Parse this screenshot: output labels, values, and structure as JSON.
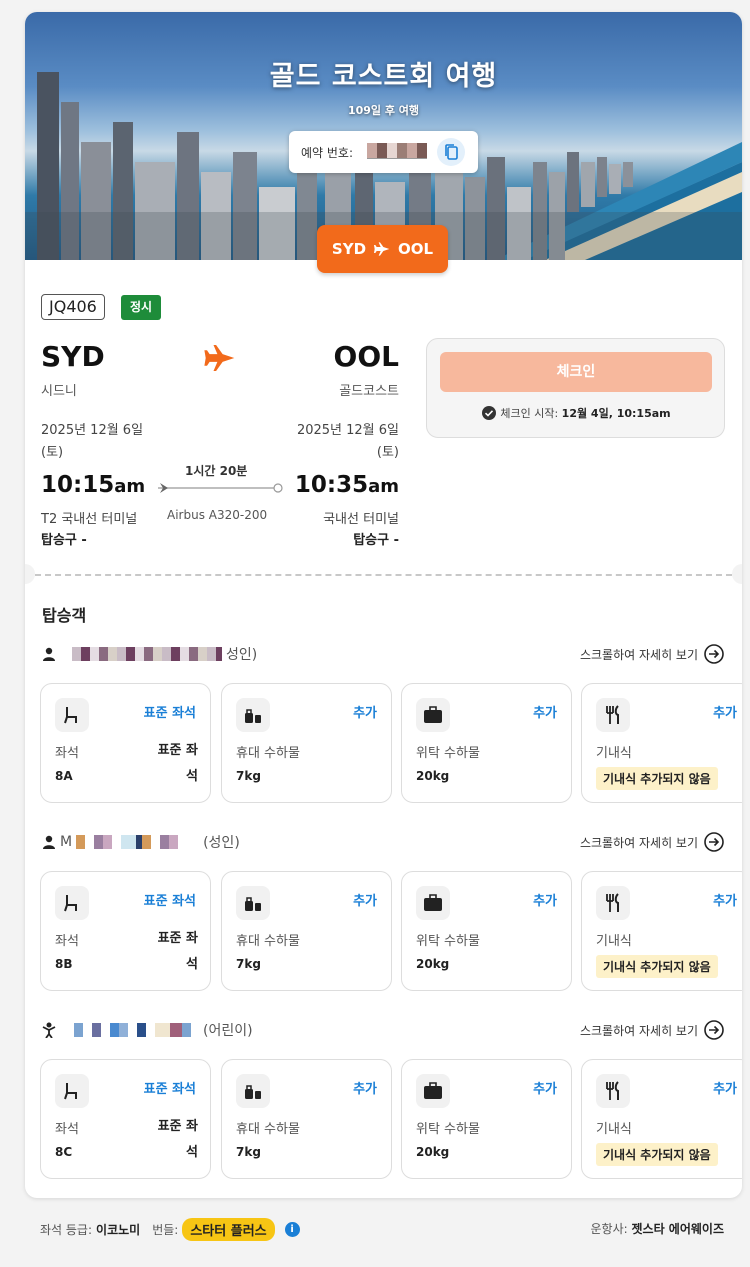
{
  "hero": {
    "title": "골드 코스트회 여행",
    "subtitle": "109일 후 여행",
    "booking_label": "예약 번호:",
    "route_from": "SYD",
    "route_to": "OOL"
  },
  "flight": {
    "number": "JQ406",
    "status": "정시",
    "origin_code": "SYD",
    "origin_city": "시드니",
    "destination_code": "OOL",
    "destination_city": "골드코스트",
    "depart_date": "2025년 12월 6일",
    "depart_day": "(토)",
    "arrive_date": "2025년 12월 6일",
    "arrive_day": "(토)",
    "depart_time": "10:15",
    "depart_ampm": "am",
    "arrive_time": "10:35",
    "arrive_ampm": "am",
    "duration": "1시간 20분",
    "aircraft": "Airbus A320-200",
    "depart_terminal": "T2 국내선 터미널",
    "arrive_terminal": "국내선 터미널",
    "depart_gate": "탑승구 -",
    "arrive_gate": "탑승구 -"
  },
  "checkin": {
    "button": "체크인",
    "note_label": "체크인 시작:",
    "note_value": "12월 4일, 10:15am"
  },
  "passengers_heading": "탑승객",
  "scroll_hint": "스크롤하여 자세히 보기",
  "service_labels": {
    "seat": "좌석",
    "seat_type": "표준 좌석",
    "add": "추가",
    "carry_on": "휴대 수하물",
    "checked": "위탁 수하물",
    "meal": "기내식",
    "meal_none": "기내식 추가되지 않음",
    "seat_right_1": "표준 좌",
    "seat_right_2": "석"
  },
  "passengers": [
    {
      "name_prefix": "",
      "type": "성인)",
      "seat": "8A",
      "carry_on": "7kg",
      "checked": "20kg",
      "icon": "person-icon"
    },
    {
      "name_prefix": "M",
      "type": "(성인)",
      "seat": "8B",
      "carry_on": "7kg",
      "checked": "20kg",
      "icon": "person-icon"
    },
    {
      "name_prefix": "",
      "type": "(어린이)",
      "seat": "8C",
      "carry_on": "7kg",
      "checked": "20kg",
      "icon": "child-icon"
    }
  ],
  "footer": {
    "class_label": "좌석 등급:",
    "class_value": "이코노미",
    "fare_label": "번들:",
    "fare_value": "스타터 플러스",
    "operator_label": "운항사:",
    "operator_value": "젯스타 에어웨이즈"
  },
  "colors": {
    "accent_orange": "#f26a1b",
    "status_green": "#1e8c3a",
    "link_blue": "#1a7fd6",
    "checkin_disabled": "#f7b89d",
    "fare_yellow": "#f7c514"
  }
}
